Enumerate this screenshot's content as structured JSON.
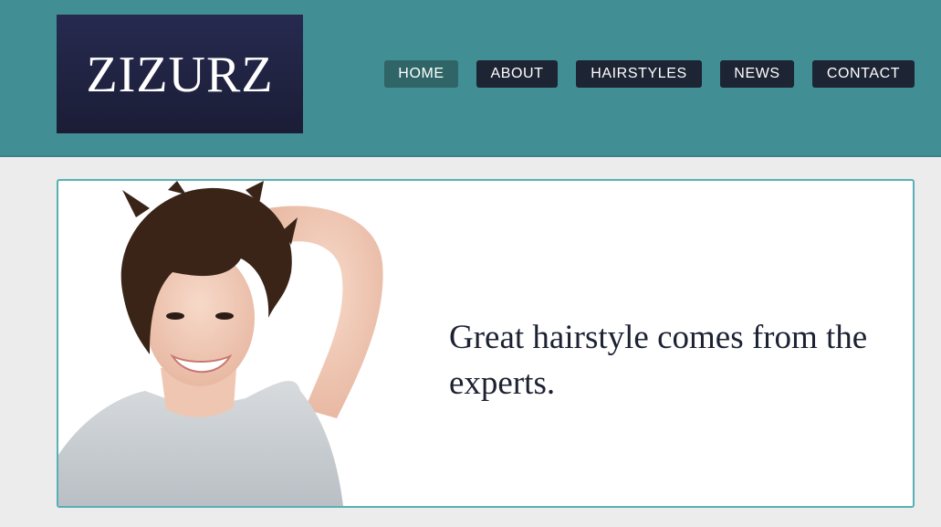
{
  "site": {
    "logo_text": "ZIZURZ"
  },
  "nav": {
    "items": [
      {
        "label": "HOME",
        "active": true
      },
      {
        "label": "ABOUT",
        "active": false
      },
      {
        "label": "HAIRSTYLES",
        "active": false
      },
      {
        "label": "NEWS",
        "active": false
      },
      {
        "label": "CONTACT",
        "active": false
      }
    ]
  },
  "hero": {
    "headline": "Great hairstyle comes from the experts.",
    "image_icon": "smiling-woman-photo"
  },
  "colors": {
    "header_bg": "#418f94",
    "logo_bg": "#1f2240",
    "nav_bg": "#1d2433",
    "nav_active_bg": "#2f6566",
    "page_bg": "#ececec",
    "hero_border": "#58b0b4",
    "headline_color": "#1d2233"
  }
}
